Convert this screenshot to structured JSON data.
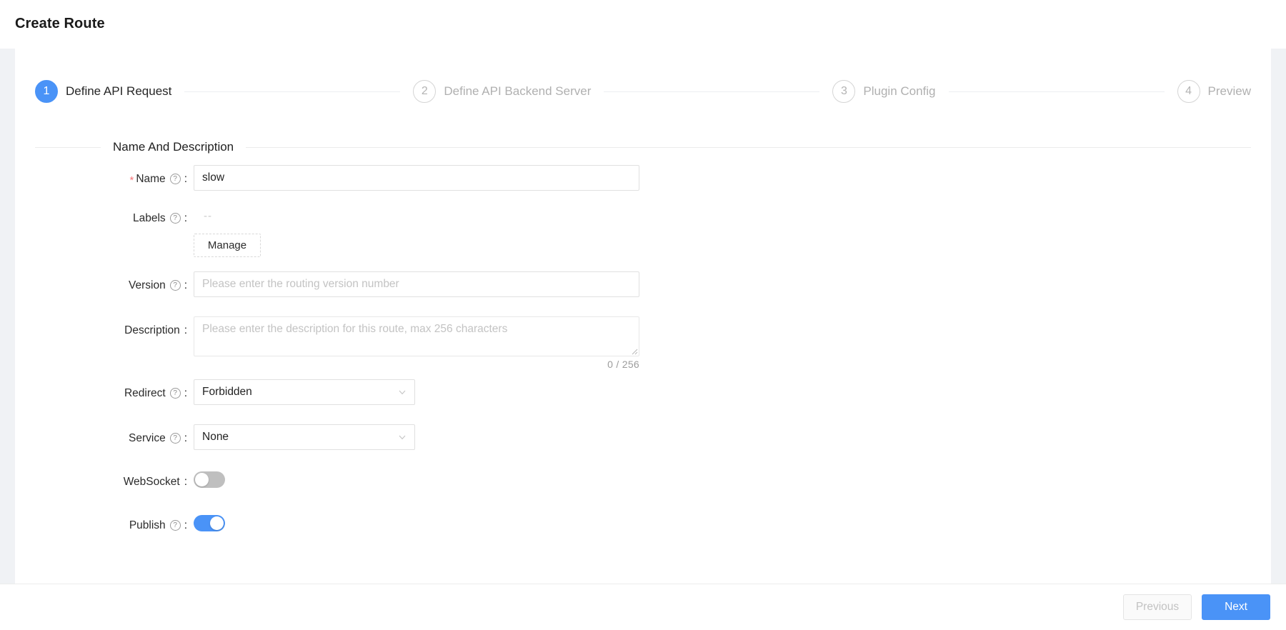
{
  "header": {
    "title": "Create Route"
  },
  "steps": [
    {
      "num": "1",
      "label": "Define API Request",
      "state": "active"
    },
    {
      "num": "2",
      "label": "Define API Backend Server",
      "state": "idle"
    },
    {
      "num": "3",
      "label": "Plugin Config",
      "state": "idle"
    },
    {
      "num": "4",
      "label": "Preview",
      "state": "idle"
    }
  ],
  "section": {
    "title": "Name And Description"
  },
  "fields": {
    "name": {
      "label": "Name",
      "required_marker": "*",
      "help_icon": "?",
      "colon": ":",
      "value": "slow",
      "placeholder": ""
    },
    "labels": {
      "label": "Labels",
      "help_icon": "?",
      "colon": ":",
      "value": "--",
      "manage_button": "Manage"
    },
    "version": {
      "label": "Version",
      "help_icon": "?",
      "colon": ":",
      "value": "",
      "placeholder": "Please enter the routing version number"
    },
    "description": {
      "label": "Description",
      "colon": ":",
      "value": "",
      "placeholder": "Please enter the description for this route, max 256 characters",
      "char_count": "0 / 256"
    },
    "redirect": {
      "label": "Redirect",
      "help_icon": "?",
      "colon": ":",
      "value": "Forbidden"
    },
    "service": {
      "label": "Service",
      "help_icon": "?",
      "colon": ":",
      "value": "None"
    },
    "websocket": {
      "label": "WebSocket",
      "colon": ":",
      "state": "off"
    },
    "publish": {
      "label": "Publish",
      "help_icon": "?",
      "colon": ":",
      "state": "on"
    }
  },
  "footer": {
    "previous_label": "Previous",
    "next_label": "Next"
  },
  "colors": {
    "accent": "#4a93f7",
    "required": "#f5767a",
    "page_bg": "#f0f2f5",
    "toggle_off": "#bfbfbf"
  }
}
